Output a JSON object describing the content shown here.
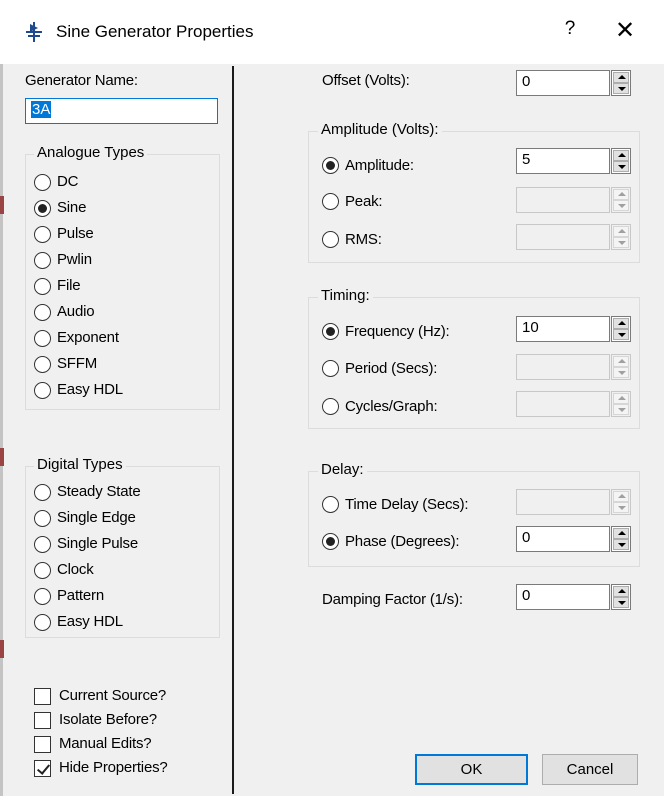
{
  "window": {
    "title": "Sine Generator Properties",
    "help": "?",
    "close": "✕"
  },
  "left": {
    "generator_name_label": "Generator Name:",
    "generator_name_value": "3A",
    "analogue_title": "Analogue Types",
    "analogue_types": [
      {
        "label": "DC",
        "checked": false
      },
      {
        "label": "Sine",
        "checked": true
      },
      {
        "label": "Pulse",
        "checked": false
      },
      {
        "label": "Pwlin",
        "checked": false
      },
      {
        "label": "File",
        "checked": false
      },
      {
        "label": "Audio",
        "checked": false
      },
      {
        "label": "Exponent",
        "checked": false
      },
      {
        "label": "SFFM",
        "checked": false
      },
      {
        "label": "Easy HDL",
        "checked": false
      }
    ],
    "digital_title": "Digital Types",
    "digital_types": [
      {
        "label": "Steady State",
        "checked": false
      },
      {
        "label": "Single Edge",
        "checked": false
      },
      {
        "label": "Single Pulse",
        "checked": false
      },
      {
        "label": "Clock",
        "checked": false
      },
      {
        "label": "Pattern",
        "checked": false
      },
      {
        "label": "Easy HDL",
        "checked": false
      }
    ],
    "checkboxes": [
      {
        "label": "Current Source?",
        "checked": false
      },
      {
        "label": "Isolate Before?",
        "checked": false
      },
      {
        "label": "Manual Edits?",
        "checked": false
      },
      {
        "label": "Hide Properties?",
        "checked": true
      }
    ]
  },
  "right": {
    "offset_label": "Offset (Volts):",
    "offset_value": "0",
    "amplitude_group": "Amplitude (Volts):",
    "amplitude": {
      "label": "Amplitude:",
      "value": "5",
      "checked": true
    },
    "peak": {
      "label": "Peak:",
      "value": "",
      "checked": false
    },
    "rms": {
      "label": "RMS:",
      "value": "",
      "checked": false
    },
    "timing_group": "Timing:",
    "frequency": {
      "label": "Frequency (Hz):",
      "value": "10",
      "checked": true
    },
    "period": {
      "label": "Period (Secs):",
      "value": "",
      "checked": false
    },
    "cycles": {
      "label": "Cycles/Graph:",
      "value": "",
      "checked": false
    },
    "delay_group": "Delay:",
    "time_delay": {
      "label": "Time Delay (Secs):",
      "value": "",
      "checked": false
    },
    "phase": {
      "label": "Phase (Degrees):",
      "value": "0",
      "checked": true
    },
    "damping_label": "Damping Factor (1/s):",
    "damping_value": "0"
  },
  "buttons": {
    "ok": "OK",
    "cancel": "Cancel"
  },
  "colors": {
    "accent": "#0078d7",
    "dialog_bg": "#f0f0f0"
  }
}
